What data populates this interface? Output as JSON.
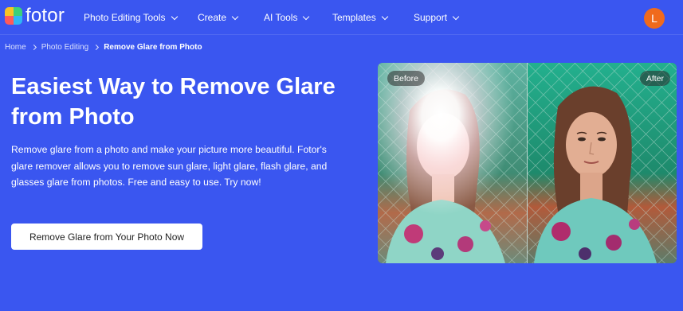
{
  "brand": {
    "name": "fotor"
  },
  "nav": {
    "items": [
      {
        "label": "Photo Editing Tools"
      },
      {
        "label": "Create"
      },
      {
        "label": "AI Tools"
      },
      {
        "label": "Templates"
      },
      {
        "label": "Support"
      }
    ],
    "avatar_initial": "L"
  },
  "breadcrumb": {
    "items": [
      "Home",
      "Photo Editing",
      "Remove Glare from Photo"
    ]
  },
  "hero": {
    "title": "Easiest Way to Remove Glare from Photo",
    "description": "Remove glare from a photo and make your picture more beautiful. Fotor's glare remover allows you to remove sun glare, light glare, flash glare, and glasses glare from photos. Free and easy to use. Try now!",
    "cta_label": "Remove Glare from Your Photo Now"
  },
  "compare": {
    "before_label": "Before",
    "after_label": "After"
  },
  "colors": {
    "background": "#3a56f0",
    "avatar": "#f06a1c",
    "button_bg": "#ffffff"
  }
}
